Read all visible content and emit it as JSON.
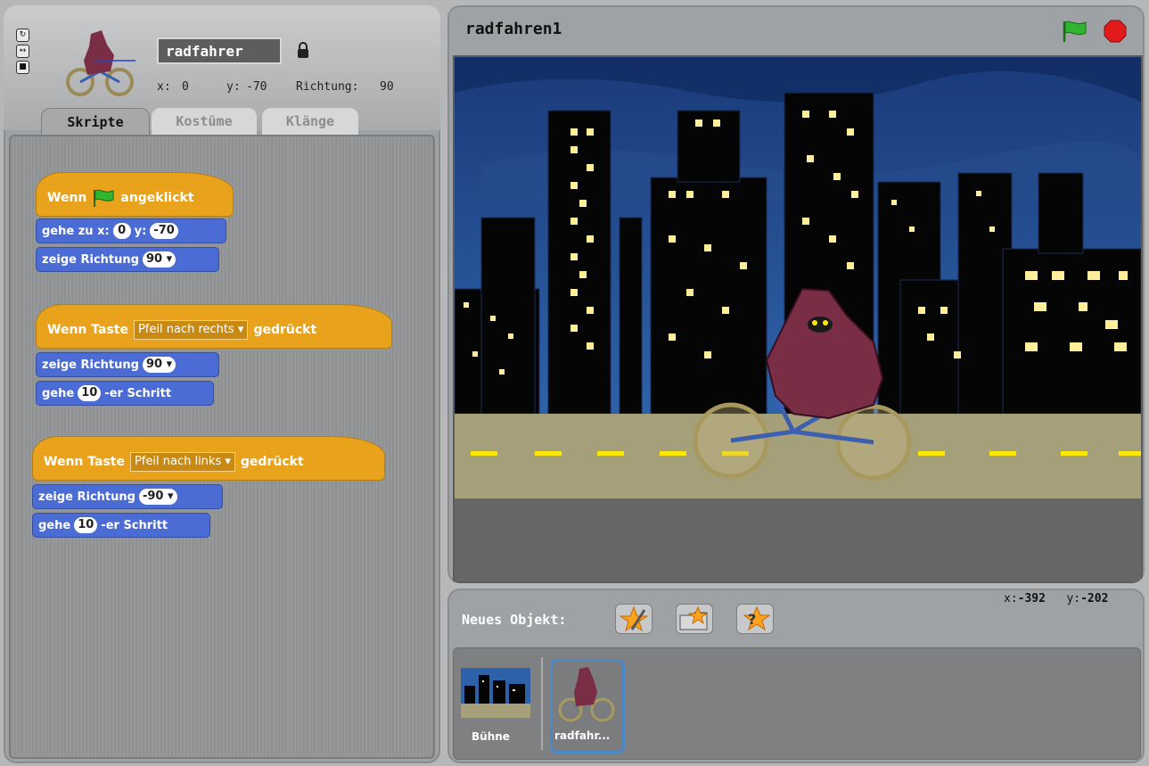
{
  "sprite": {
    "name": "radfahrer",
    "x_label": "x:",
    "x_value": "0",
    "y_label": "y:",
    "y_value": "-70",
    "direction_label": "Richtung:",
    "direction_value": "90"
  },
  "tabs": [
    {
      "label": "Skripte",
      "active": true
    },
    {
      "label": "Kostüme",
      "active": false
    },
    {
      "label": "Klänge",
      "active": false
    }
  ],
  "scripts": {
    "s1": {
      "hat_pre": "Wenn",
      "hat_post": "angeklickt",
      "b1_pre": "gehe zu x:",
      "b1_x": "0",
      "b1_mid": "y:",
      "b1_y": "-70",
      "b2_pre": "zeige Richtung",
      "b2_val": "90"
    },
    "s2": {
      "hat_pre": "Wenn Taste",
      "hat_key": "Pfeil nach rechts",
      "hat_post": "gedrückt",
      "b1_pre": "zeige Richtung",
      "b1_val": "90",
      "b2_pre": "gehe",
      "b2_val": "10",
      "b2_post": "-er Schritt"
    },
    "s3": {
      "hat_pre": "Wenn Taste",
      "hat_key": "Pfeil nach links",
      "hat_post": "gedrückt",
      "b1_pre": "zeige Richtung",
      "b1_val": "-90",
      "b2_pre": "gehe",
      "b2_val": "10",
      "b2_post": "-er Schritt"
    }
  },
  "stage": {
    "title": "radfahren1",
    "mouse_x_label": "x:",
    "mouse_x": "-392",
    "mouse_y_label": "y:",
    "mouse_y": "-202"
  },
  "new_sprite": {
    "label": "Neues Objekt:"
  },
  "sprite_list": {
    "stage_label": "Bühne",
    "items": [
      {
        "label": "radfahr..."
      }
    ]
  },
  "colors": {
    "control_hat": "#e8a21c",
    "motion_block": "#4a6cd4",
    "green_flag": "#2fb52f",
    "stop": "#e11b1b",
    "road_line": "#ffe800"
  }
}
